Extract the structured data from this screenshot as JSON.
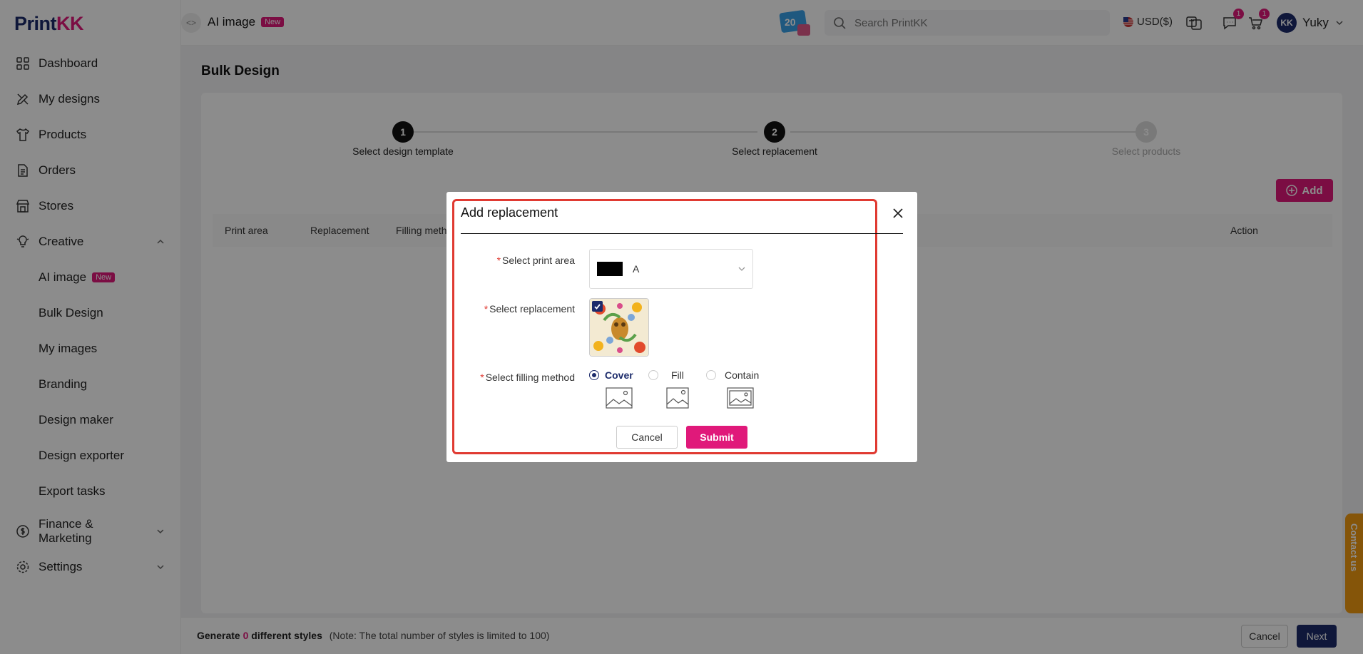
{
  "sidebar": {
    "logo_main": "Print",
    "logo_accent": "KK",
    "items": [
      {
        "label": "Dashboard"
      },
      {
        "label": "My designs"
      },
      {
        "label": "Products"
      },
      {
        "label": "Orders"
      },
      {
        "label": "Stores"
      },
      {
        "label": "Creative"
      }
    ],
    "creative_sub": [
      {
        "label": "AI image",
        "badge": "New"
      },
      {
        "label": "Bulk Design"
      },
      {
        "label": "My images"
      },
      {
        "label": "Branding"
      },
      {
        "label": "Design maker"
      },
      {
        "label": "Design exporter"
      },
      {
        "label": "Export tasks"
      }
    ],
    "finance": "Finance & Marketing",
    "settings": "Settings"
  },
  "topbar": {
    "title": "AI image",
    "title_badge": "New",
    "search_placeholder": "Search PrintKK",
    "currency": "USD($)",
    "messages_count": "1",
    "cart_count": "1",
    "user_initials": "KK",
    "user_name": "Yuky"
  },
  "page": {
    "title": "Bulk Design",
    "steps": [
      {
        "num": "1",
        "label": "Select design template"
      },
      {
        "num": "2",
        "label": "Select replacement"
      },
      {
        "num": "3",
        "label": "Select products"
      }
    ],
    "add_label": "Add",
    "table_headers": [
      "Print area",
      "Replacement",
      "Filling meth",
      "Action"
    ]
  },
  "footer": {
    "prefix": "Generate",
    "count": "0",
    "suffix": "different styles",
    "note": "(Note: The total number of styles is limited to 100)",
    "cancel": "Cancel",
    "next": "Next"
  },
  "contact": "Contact us",
  "modal": {
    "title": "Add replacement",
    "print_area_label": "Select print area",
    "print_area_value": "A",
    "replacement_label": "Select replacement",
    "filling_label": "Select filling method",
    "filling_options": [
      "Cover",
      "Fill",
      "Contain"
    ],
    "filling_selected": "Cover",
    "cancel": "Cancel",
    "submit": "Submit"
  },
  "colors": {
    "brand_pink": "#e0197a",
    "brand_navy": "#1c2b6b",
    "highlight_red": "#e03a32"
  }
}
